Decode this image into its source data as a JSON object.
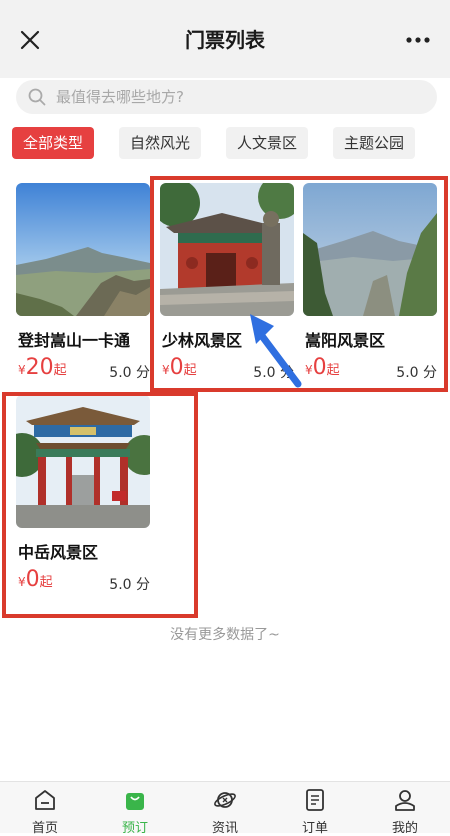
{
  "header": {
    "title": "门票列表",
    "close_icon": "close-icon",
    "more_icon": "more-dots-icon"
  },
  "search": {
    "placeholder": "最值得去哪些地方?"
  },
  "filters": [
    {
      "label": "全部类型",
      "active": true
    },
    {
      "label": "自然风光",
      "active": false
    },
    {
      "label": "人文景区",
      "active": false
    },
    {
      "label": "主题公园",
      "active": false
    }
  ],
  "items": [
    {
      "name": "登封嵩山一卡通",
      "currency": "¥",
      "price": "20",
      "unit": "起",
      "rating": "5.0 分"
    },
    {
      "name": "少林风景区",
      "currency": "¥",
      "price": "0",
      "unit": "起",
      "rating": "5.0 分"
    },
    {
      "name": "嵩阳风景区",
      "currency": "¥",
      "price": "0",
      "unit": "起",
      "rating": "5.0 分"
    },
    {
      "name": "中岳风景区",
      "currency": "¥",
      "price": "0",
      "unit": "起",
      "rating": "5.0 分"
    }
  ],
  "footer_note": "没有更多数据了~",
  "tabbar": [
    {
      "label": "首页",
      "icon": "home-icon",
      "active": false
    },
    {
      "label": "预订",
      "icon": "shopping-bag-icon",
      "active": true
    },
    {
      "label": "资讯",
      "icon": "planet-icon",
      "active": false
    },
    {
      "label": "订单",
      "icon": "document-icon",
      "active": false
    },
    {
      "label": "我的",
      "icon": "user-icon",
      "active": false
    }
  ],
  "colors": {
    "accent_red": "#e64040",
    "annotation_red": "#d93a2c",
    "tab_active": "#3ab54a",
    "arrow_blue": "#2f6fe0"
  }
}
